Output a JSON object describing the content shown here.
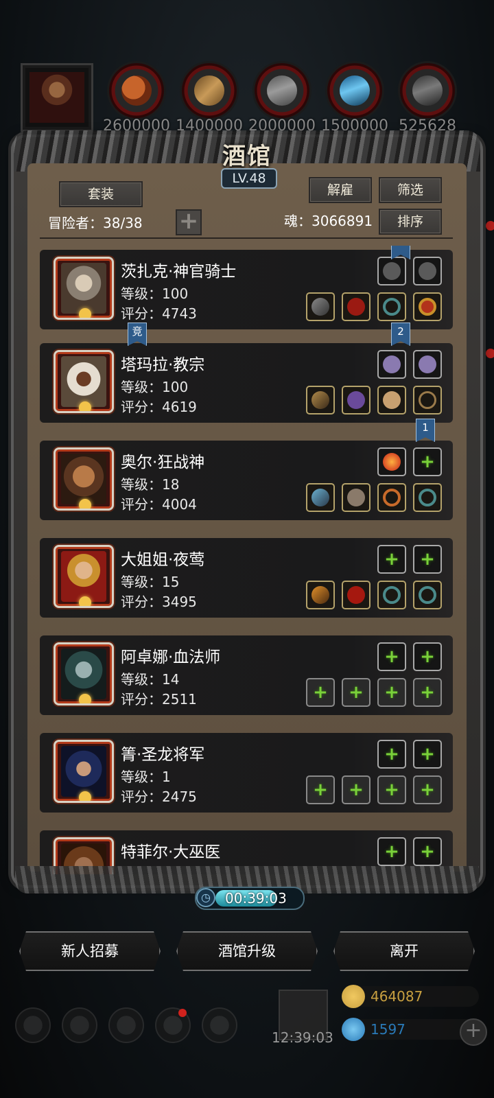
{
  "top_bar": {
    "resources": [
      {
        "icon": "meat-icon",
        "value": "2600000"
      },
      {
        "icon": "wood-icon",
        "value": "1400000"
      },
      {
        "icon": "iron-icon",
        "value": "2000000"
      },
      {
        "icon": "crystal-icon",
        "value": "1500000"
      },
      {
        "icon": "steel-icon",
        "value": "525628"
      }
    ]
  },
  "tavern": {
    "title": "酒馆",
    "level": "LV.48",
    "set_button": "套装",
    "dismiss_button": "解雇",
    "filter_button": "筛选",
    "sort_button": "排序",
    "adventurers_label": "冒险者：38/38",
    "soul_label": "魂：3066891",
    "timer": "00:39:03",
    "timer_progress": 0.75,
    "heroes": [
      {
        "name": "茨扎克·神官骑士",
        "level": "等级：100",
        "score": "评分：4743"
      },
      {
        "name": "塔玛拉·教宗",
        "level": "等级：100",
        "score": "评分：4619"
      },
      {
        "name": "奥尔·狂战神",
        "level": "等级：18",
        "score": "评分：4004"
      },
      {
        "name": "大姐姐·夜莺",
        "level": "等级：15",
        "score": "评分：3495"
      },
      {
        "name": "阿卓娜·血法师",
        "level": "等级：14",
        "score": "评分：2511"
      },
      {
        "name": "箐·圣龙将军",
        "level": "等级：1",
        "score": "评分：2475"
      },
      {
        "name": "特菲尔·大巫医",
        "level": "",
        "score": ""
      }
    ],
    "ribbons": {
      "compete": "竞",
      "two": "2",
      "one": "1"
    }
  },
  "actions": {
    "recruit": "新人招募",
    "upgrade": "酒馆升级",
    "leave": "离开"
  },
  "footer": {
    "gift_time": "12:39:03",
    "gold": "464087",
    "gems": "1597",
    "gold_color": "#c8a040",
    "gem_color": "#2a7ab8"
  }
}
